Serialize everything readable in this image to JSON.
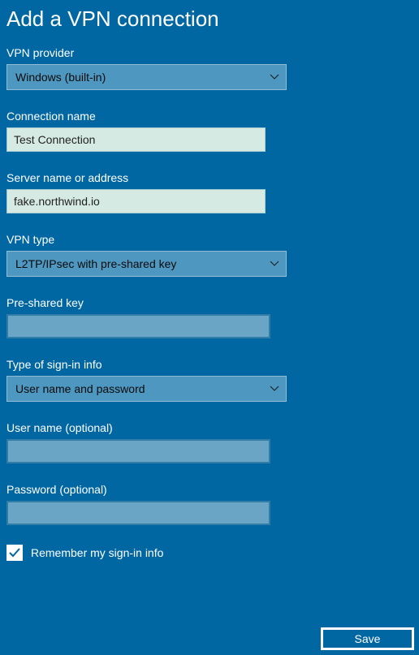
{
  "title": "Add a VPN connection",
  "fields": {
    "vpn_provider": {
      "label": "VPN provider",
      "value": "Windows (built-in)"
    },
    "connection_name": {
      "label": "Connection name",
      "value": "Test Connection"
    },
    "server_name": {
      "label": "Server name or address",
      "value": "fake.northwind.io"
    },
    "vpn_type": {
      "label": "VPN type",
      "value": "L2TP/IPsec with pre-shared key"
    },
    "pre_shared_key": {
      "label": "Pre-shared key",
      "value": ""
    },
    "sign_in_type": {
      "label": "Type of sign-in info",
      "value": "User name and password"
    },
    "username": {
      "label": "User name (optional)",
      "value": ""
    },
    "password": {
      "label": "Password (optional)",
      "value": ""
    }
  },
  "remember": {
    "label": "Remember my sign-in info",
    "checked": true
  },
  "buttons": {
    "save": "Save"
  }
}
